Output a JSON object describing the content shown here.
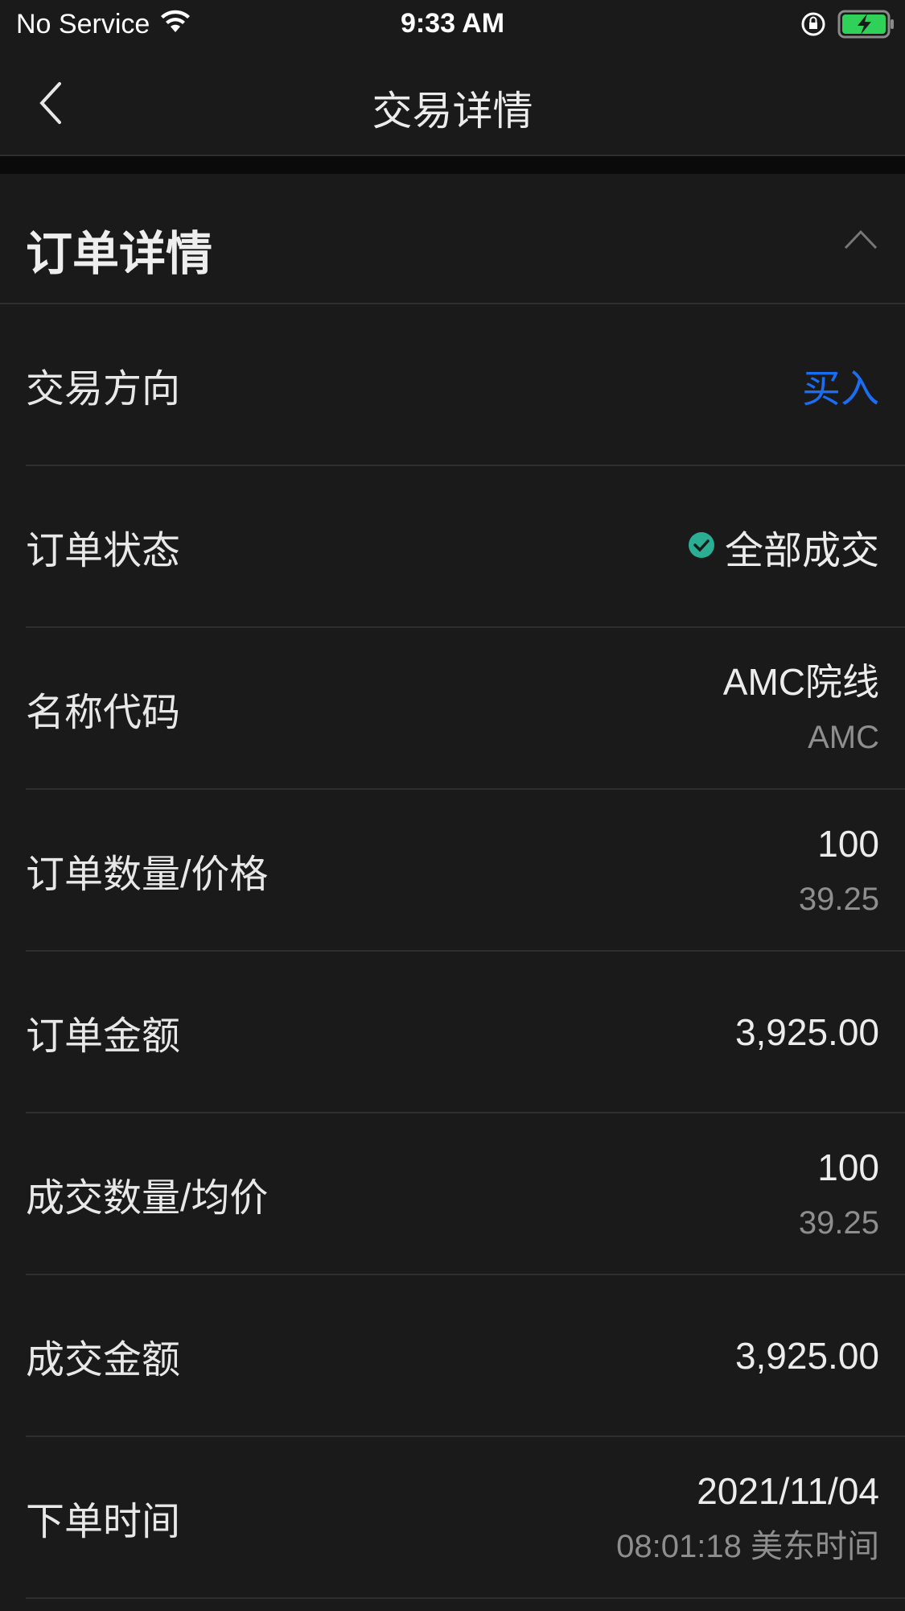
{
  "status_bar": {
    "carrier": "No Service",
    "time": "9:33 AM",
    "battery_color": "#30d158"
  },
  "nav": {
    "title": "交易详情"
  },
  "section": {
    "title": "订单详情"
  },
  "rows": [
    {
      "label": "交易方向",
      "value": "买入"
    },
    {
      "label": "订单状态",
      "value": "全部成交"
    },
    {
      "label": "名称代码",
      "value": "AMC院线",
      "sub": "AMC"
    },
    {
      "label": "订单数量/价格",
      "value": "100",
      "sub": "39.25"
    },
    {
      "label": "订单金额",
      "value": "3,925.00"
    },
    {
      "label": "成交数量/均价",
      "value": "100",
      "sub": "39.25"
    },
    {
      "label": "成交金额",
      "value": "3,925.00"
    },
    {
      "label": "下单时间",
      "value": "2021/11/04",
      "sub": "08:01:18 美东时间"
    }
  ],
  "colors": {
    "accent_blue": "#1b6ef3",
    "status_green": "#2aae94"
  }
}
